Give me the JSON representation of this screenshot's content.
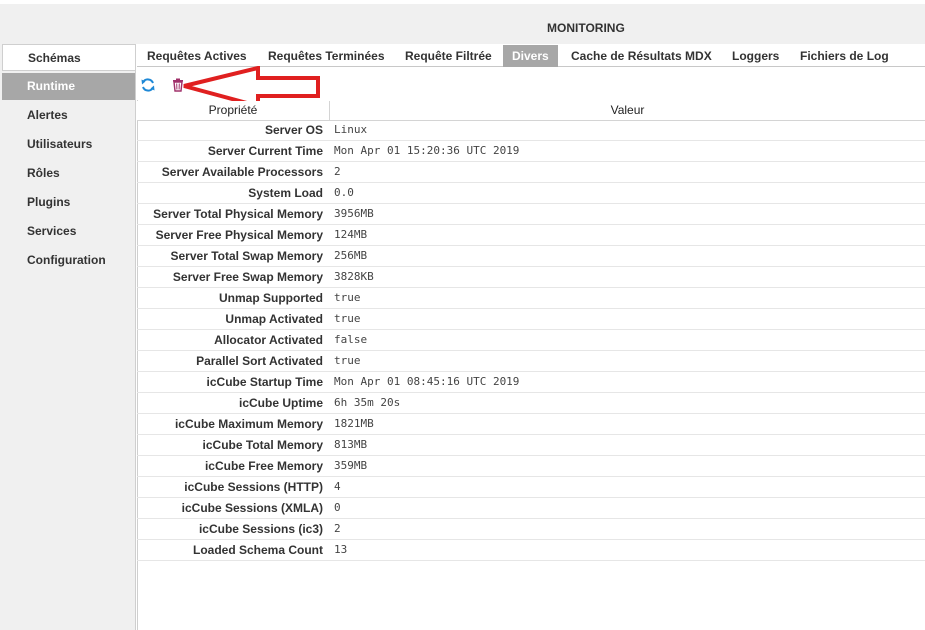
{
  "app": {
    "title": "MONITORING"
  },
  "sidebar": {
    "items": [
      {
        "label": "Schémas"
      },
      {
        "label": "Runtime"
      },
      {
        "label": "Alertes"
      },
      {
        "label": "Utilisateurs"
      },
      {
        "label": "Rôles"
      },
      {
        "label": "Plugins"
      },
      {
        "label": "Services"
      },
      {
        "label": "Configuration"
      }
    ],
    "active": "Runtime"
  },
  "tabs": [
    {
      "label": "Requêtes Actives"
    },
    {
      "label": "Requêtes Terminées"
    },
    {
      "label": "Requête Filtrée"
    },
    {
      "label": "Divers"
    },
    {
      "label": "Cache de Résultats MDX"
    },
    {
      "label": "Loggers"
    },
    {
      "label": "Fichiers de Log"
    }
  ],
  "active_tab": "Divers",
  "toolbar": {
    "refresh_icon": "refresh-icon",
    "delete_icon": "trash-icon",
    "accent_blue": "#1e88d6",
    "accent_purple": "#a0306a"
  },
  "annotation": {
    "arrow_color": "#e02020"
  },
  "table": {
    "headers": {
      "property": "Propriété",
      "value": "Valeur"
    },
    "rows": [
      {
        "k": "Server OS",
        "v": "Linux"
      },
      {
        "k": "Server Current Time",
        "v": "Mon Apr 01 15:20:36 UTC 2019"
      },
      {
        "k": "Server Available Processors",
        "v": "2"
      },
      {
        "k": "System Load",
        "v": "0.0"
      },
      {
        "k": "Server Total Physical Memory",
        "v": "3956MB"
      },
      {
        "k": "Server Free Physical Memory",
        "v": "124MB"
      },
      {
        "k": "Server Total Swap Memory",
        "v": "256MB"
      },
      {
        "k": "Server Free Swap Memory",
        "v": "3828KB"
      },
      {
        "k": "Unmap Supported",
        "v": "true"
      },
      {
        "k": "Unmap Activated",
        "v": "true"
      },
      {
        "k": "Allocator Activated",
        "v": "false"
      },
      {
        "k": "Parallel Sort Activated",
        "v": "true"
      },
      {
        "k": "icCube Startup Time",
        "v": "Mon Apr 01 08:45:16 UTC 2019"
      },
      {
        "k": "icCube Uptime",
        "v": "6h 35m 20s"
      },
      {
        "k": "icCube Maximum Memory",
        "v": "1821MB"
      },
      {
        "k": "icCube Total Memory",
        "v": "813MB"
      },
      {
        "k": "icCube Free Memory",
        "v": "359MB"
      },
      {
        "k": "icCube Sessions (HTTP)",
        "v": "4"
      },
      {
        "k": "icCube Sessions (XMLA)",
        "v": "0"
      },
      {
        "k": "icCube Sessions (ic3)",
        "v": "2"
      },
      {
        "k": "Loaded Schema Count",
        "v": "13"
      }
    ]
  }
}
